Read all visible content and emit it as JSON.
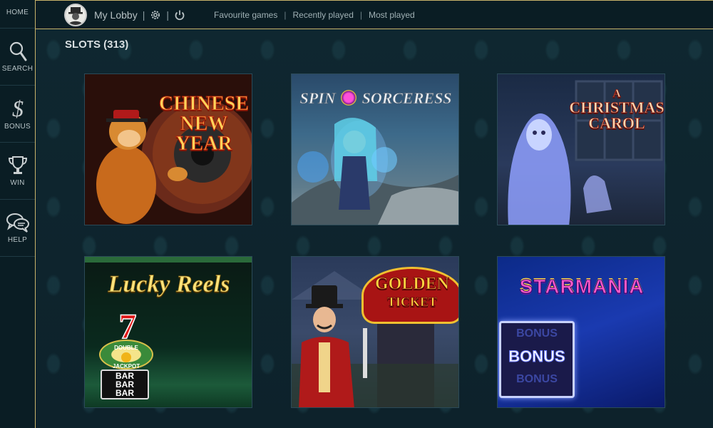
{
  "sidebar": {
    "items": [
      {
        "label": "HOME"
      },
      {
        "label": "SEARCH",
        "icon": "search-icon"
      },
      {
        "label": "BONUS",
        "icon": "dollar-icon"
      },
      {
        "label": "WIN",
        "icon": "trophy-icon"
      },
      {
        "label": "HELP",
        "icon": "chat-bubbles-icon"
      }
    ]
  },
  "topbar": {
    "lobby_label": "My Lobby",
    "nav": [
      "Favourite games",
      "Recently played",
      "Most played"
    ]
  },
  "section": {
    "title": "SLOTS (313)"
  },
  "games": [
    {
      "title_line1": "CHINESE",
      "title_line2": "NEW YEAR"
    },
    {
      "title_line1": "SPIN",
      "title_line2": "SORCERESS"
    },
    {
      "title_line1": "A",
      "title_line2": "CHRISTMAS",
      "title_line3": "CAROL"
    },
    {
      "title_line1": "Lucky Reels",
      "badge_top": "DOUBLE",
      "badge_bottom": "JACKPOT",
      "bar1": "BAR",
      "bar2": "BAR",
      "bar3": "BAR",
      "seven": "7"
    },
    {
      "title_line1": "GOLDEN",
      "title_line2": "TICKET"
    },
    {
      "title_line1": "STARMANIA",
      "bonus_text": "BONUS",
      "bonus_ghost": "BONUS"
    }
  ],
  "colors": {
    "accent_gold": "#c8b36a",
    "background": "#0f2630",
    "sidebar_bg": "#0a1d24"
  }
}
